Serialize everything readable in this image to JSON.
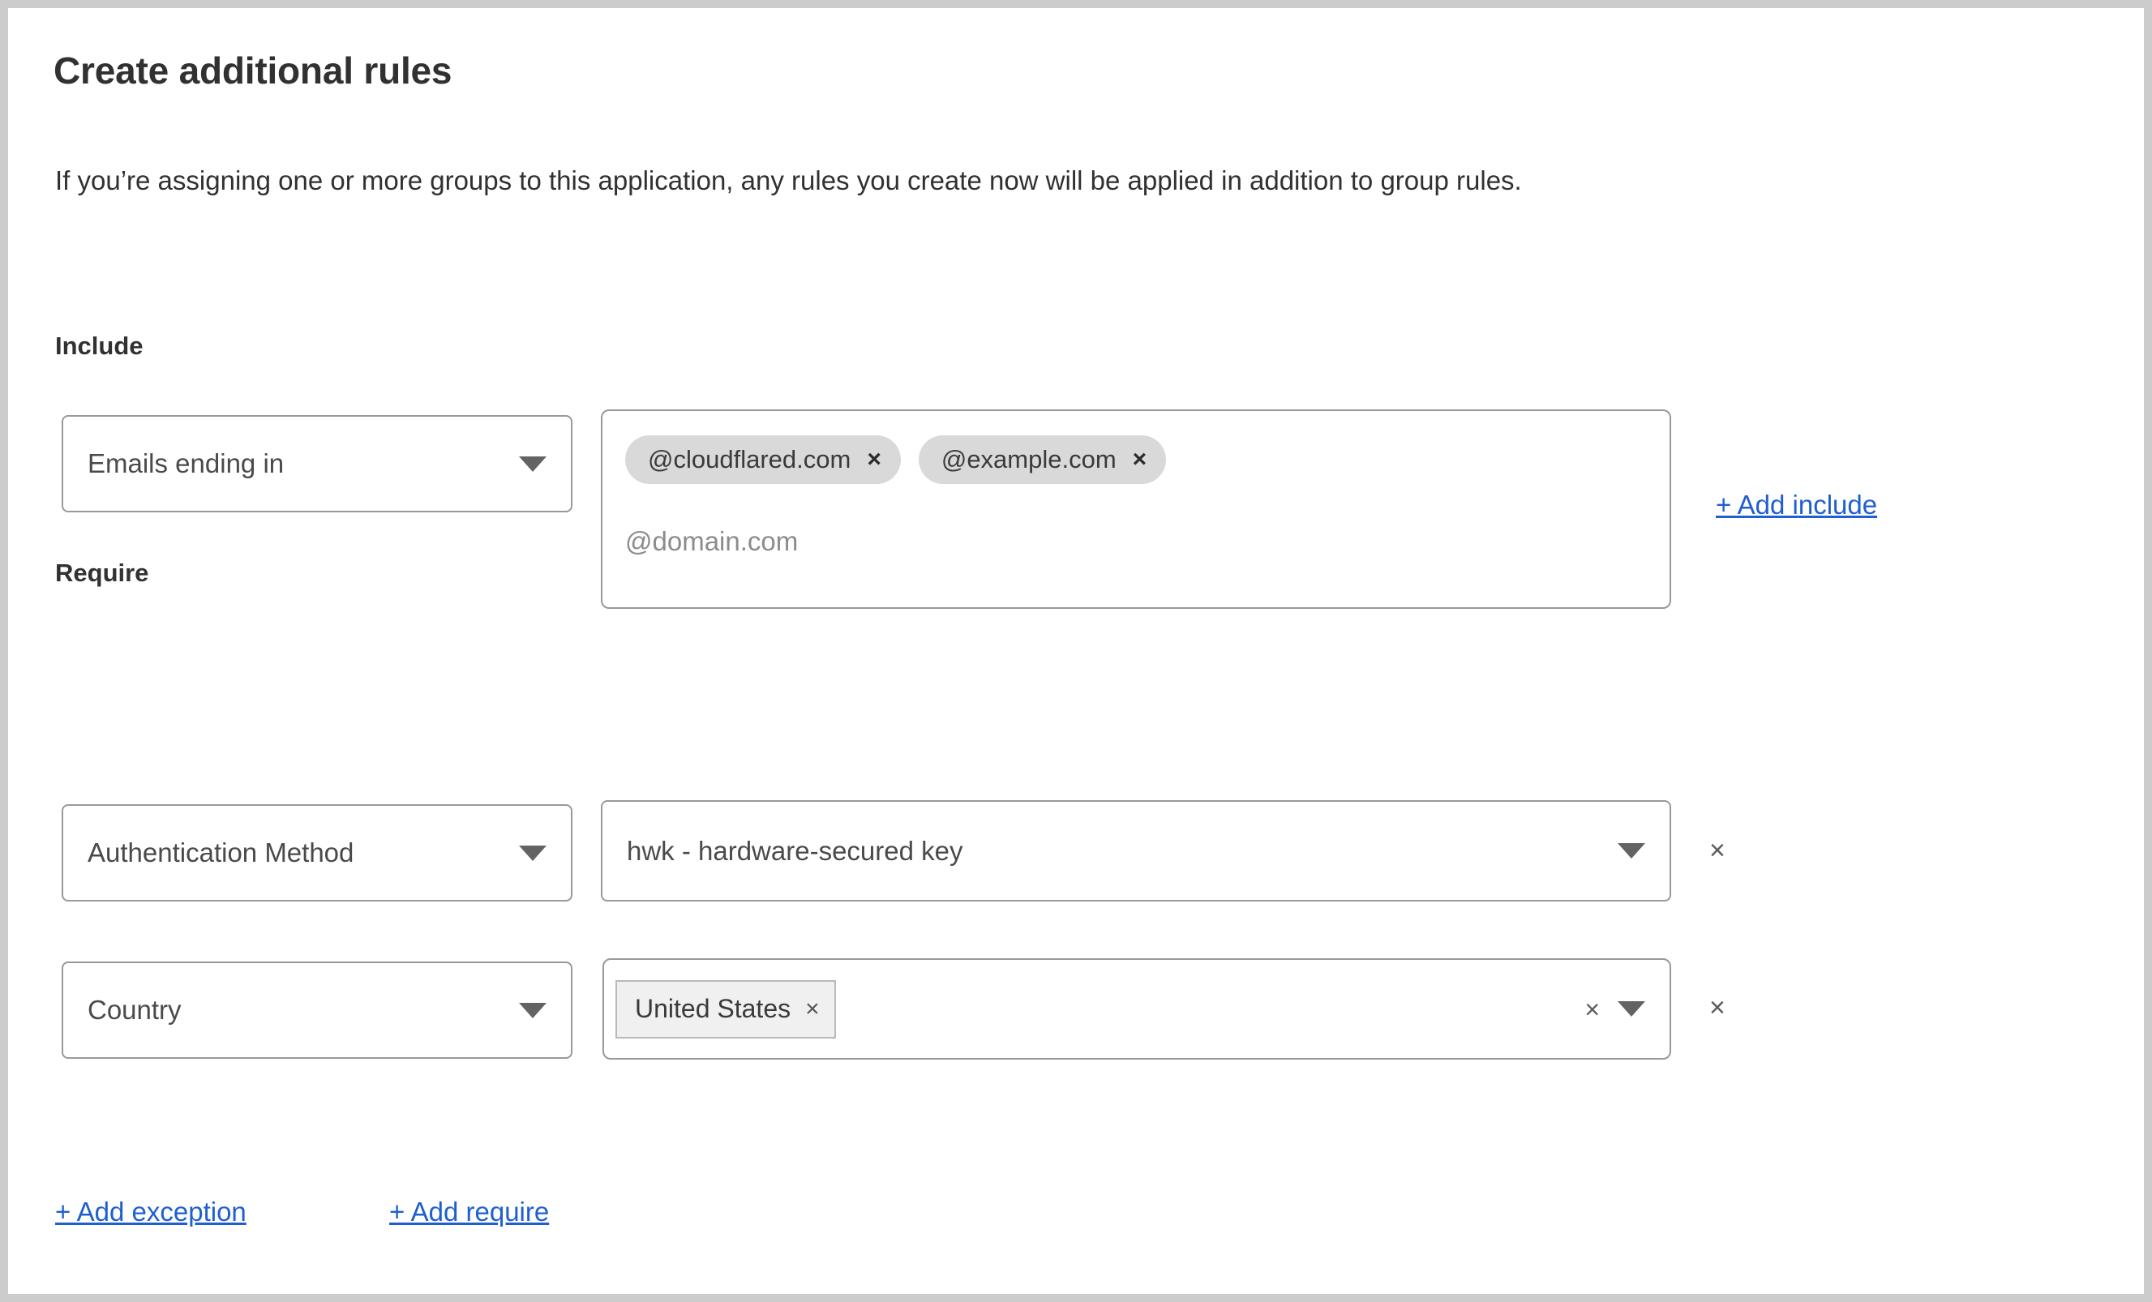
{
  "page": {
    "title": "Create additional rules",
    "description": "If you’re assigning one or more groups to this application, any rules you create now will be applied in addition to group rules."
  },
  "colors": {
    "link": "#1f5fd0",
    "text": "#313131",
    "border": "#999999",
    "pill_bg": "#d9d9d9",
    "chip_bg": "#f0f0f0",
    "frame": "#cccccc"
  },
  "include": {
    "label": "Include",
    "selector": {
      "value": "Emails ending in",
      "caret_icon": "chevron-down-icon"
    },
    "tags": [
      {
        "label": "@cloudflared.com",
        "remove_icon": "close-icon",
        "remove_glyph": "×"
      },
      {
        "label": "@example.com",
        "remove_icon": "close-icon",
        "remove_glyph": "×"
      }
    ],
    "placeholder": "@domain.com",
    "add_link": "+ Add include"
  },
  "require": {
    "label": "Require",
    "rows": [
      {
        "type": {
          "value": "Authentication Method",
          "caret_icon": "chevron-down-icon"
        },
        "value": {
          "kind": "select",
          "value": "hwk - hardware-secured key",
          "caret_icon": "chevron-down-icon"
        },
        "remove_glyph": "×",
        "remove_icon": "close-icon"
      },
      {
        "type": {
          "value": "Country",
          "caret_icon": "chevron-down-icon"
        },
        "value": {
          "kind": "multiselect",
          "chips": [
            {
              "label": "United States",
              "remove_glyph": "×",
              "remove_icon": "close-icon"
            }
          ],
          "clear_glyph": "×",
          "clear_icon": "clear-icon",
          "caret_icon": "chevron-down-icon"
        },
        "remove_glyph": "×",
        "remove_icon": "close-icon"
      }
    ]
  },
  "footer": {
    "add_exception": "+ Add exception",
    "add_require": "+ Add require"
  }
}
